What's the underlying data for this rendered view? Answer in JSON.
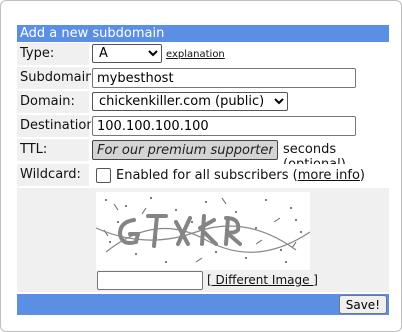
{
  "header": {
    "title": "Add a new subdomain"
  },
  "fields": {
    "type": {
      "label": "Type:",
      "value": "A",
      "explanation": "explanation"
    },
    "subdomain": {
      "label": "Subdomain:",
      "value": "mybesthost"
    },
    "domain": {
      "label": "Domain:",
      "value": "chickenkiller.com (public)"
    },
    "destination": {
      "label": "Destination:",
      "value": "100.100.100.100"
    },
    "ttl": {
      "label": "TTL:",
      "value": "For our premium supporters",
      "suffix": "seconds (optional)"
    },
    "wildcard": {
      "label": "Wildcard:",
      "text": "Enabled for all subscribers (",
      "link": "more info",
      "close": ")"
    }
  },
  "captcha": {
    "different_image": "[ Different Image ]",
    "input_value": ""
  },
  "footer": {
    "save_label": "Save!"
  },
  "colors": {
    "accent": "#5b8fe3",
    "label_bg": "#f0f0f0"
  }
}
